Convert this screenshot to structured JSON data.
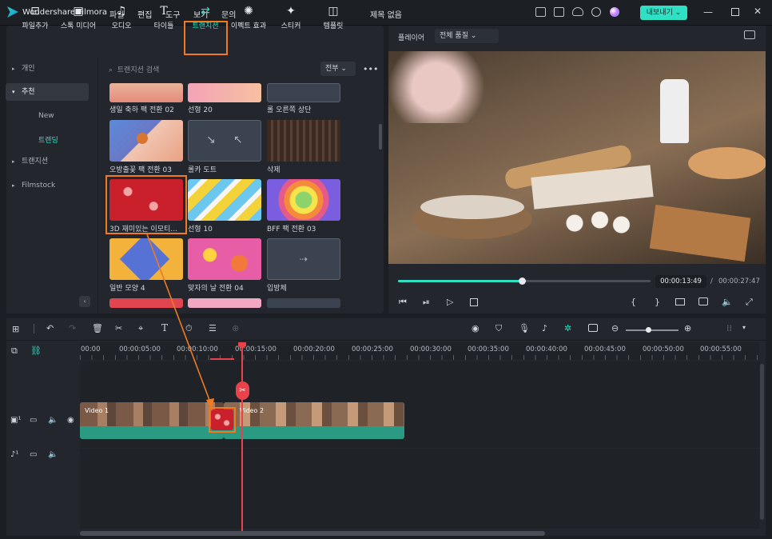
{
  "app": {
    "name": "Wondershare Filmora",
    "doc_title": "제목 없음",
    "export_label": "내보내기"
  },
  "menu": [
    "파일",
    "편집",
    "도구",
    "보기",
    "문의"
  ],
  "toolbar": [
    {
      "label": "파일추가",
      "icon": "import-icon"
    },
    {
      "label": "스톡 미디어",
      "icon": "stock-media-icon"
    },
    {
      "label": "오디오",
      "icon": "music-note-icon"
    },
    {
      "label": "타이틀",
      "icon": "title-t-icon"
    },
    {
      "label": "트랜지션",
      "icon": "transition-arrows-icon",
      "active": true
    },
    {
      "label": "이펙트 효과",
      "icon": "effects-sparkle-icon"
    },
    {
      "label": "스티커",
      "icon": "sticker-icon"
    },
    {
      "label": "템플릿",
      "icon": "template-icon"
    }
  ],
  "sidebar": {
    "items": [
      {
        "label": "개인",
        "arrow": "▸"
      },
      {
        "label": "추천",
        "arrow": "▾",
        "selected": true
      },
      {
        "label": "트랜지션",
        "arrow": "▸"
      },
      {
        "label": "Filmstock",
        "arrow": "▸"
      }
    ],
    "subitems": [
      "New",
      "트렌딩"
    ]
  },
  "search": {
    "placeholder": "트랜지션 검색",
    "filter": "전부"
  },
  "grid": {
    "row0": [
      "생일 축하 팩 전환 02",
      "선형 20",
      "롤 오른쪽 상단"
    ],
    "row1": [
      "오방출꽃 팩 전환 03",
      "롤카 도트",
      "삭제"
    ],
    "row2": [
      "3D 재미있는 이모티...",
      "선형 10",
      "BFF 팩 전환 03"
    ],
    "row3": [
      "일반 모양 4",
      "맞자의 날 전환 04",
      "입방체"
    ]
  },
  "player": {
    "label": "플레이어",
    "quality": "전체 품질",
    "current_time": "00:00:13:49",
    "separator": "/",
    "total_time": "00:00:27:47",
    "progress": 0.49
  },
  "timeline": {
    "ticks": [
      "00:00",
      "00:00:05:00",
      "00:00:10:00",
      "00:00:15:00",
      "00:00:20:00",
      "00:00:25:00",
      "00:00:30:00",
      "00:00:35:00",
      "00:00:40:00",
      "00:00:45:00",
      "00:00:50:00",
      "00:00:55:00"
    ],
    "clip1": "Video 1",
    "clip2": "Video 2"
  },
  "colors": {
    "accent": "#2fe0c4",
    "highlight": "#f07a22",
    "playhead": "#e9424b"
  }
}
